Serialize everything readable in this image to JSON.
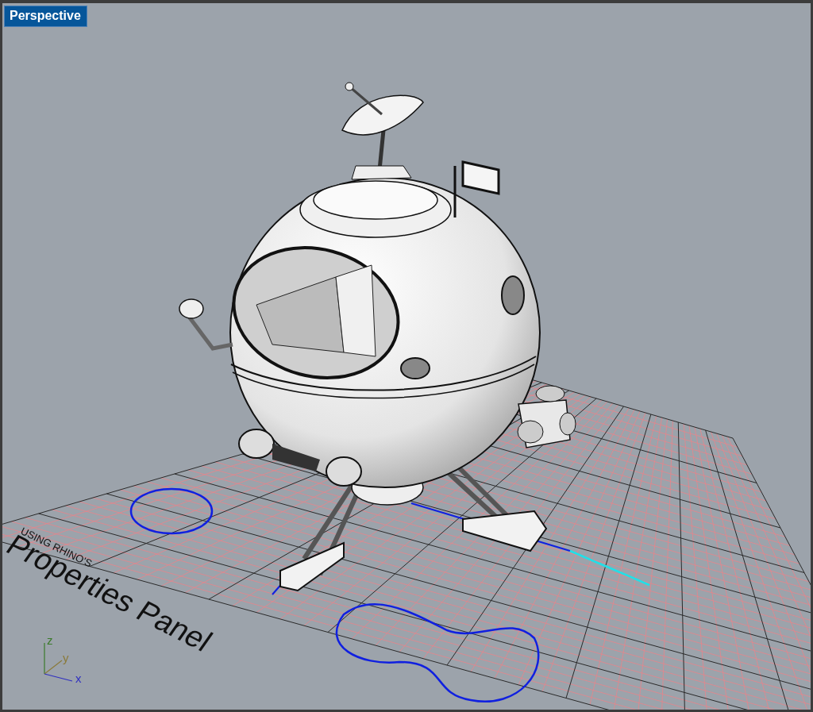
{
  "viewport": {
    "title": "Perspective",
    "scene_texts": [
      "USING RHINO'S",
      "Properties Panel"
    ],
    "axes": [
      "z",
      "y",
      "x"
    ]
  }
}
